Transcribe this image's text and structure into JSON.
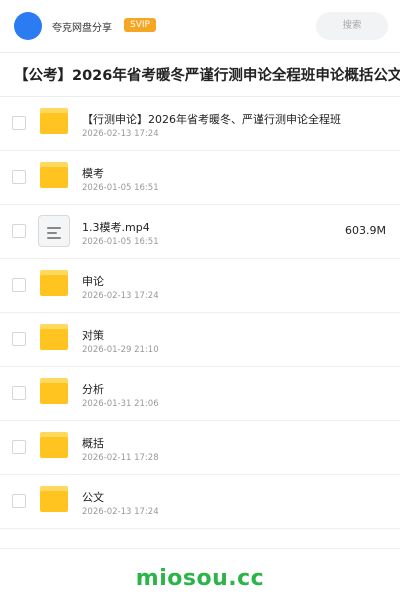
{
  "header": {
    "brand": "夸克网盘分享",
    "badge": "SVIP",
    "search_placeholder": "搜索"
  },
  "title": "【公考】2026年省考暖冬严谨行测申论全程班申论概括公文",
  "items": [
    {
      "type": "folder",
      "icon": "folder-icon",
      "name": "【行测申论】2026年省考暖冬、严谨行测申论全程班",
      "date": "2026-02-13 17:24"
    },
    {
      "type": "folder",
      "icon": "folder-icon",
      "name": "模考",
      "date": "2026-01-05 16:51"
    },
    {
      "type": "file",
      "icon": "video-file-icon",
      "name": "1.3模考.mp4",
      "date": "2026-01-05 16:51",
      "size": "603.9M"
    },
    {
      "type": "folder",
      "icon": "folder-icon",
      "name": "申论",
      "date": "2026-02-13 17:24"
    },
    {
      "type": "folder",
      "icon": "folder-icon",
      "name": "对策",
      "date": "2026-01-29 21:10"
    },
    {
      "type": "folder",
      "icon": "folder-icon",
      "name": "分析",
      "date": "2026-01-31 21:06"
    },
    {
      "type": "folder",
      "icon": "folder-icon",
      "name": "概括",
      "date": "2026-02-11 17:28"
    },
    {
      "type": "folder",
      "icon": "folder-icon",
      "name": "公文",
      "date": "2026-02-13 17:24"
    }
  ],
  "watermark": "miosou.cc",
  "colors": {
    "avatar": "#2b7bf3",
    "badge": "#f5a623",
    "folder": "#ffc420",
    "watermark": "#2bb44a"
  }
}
